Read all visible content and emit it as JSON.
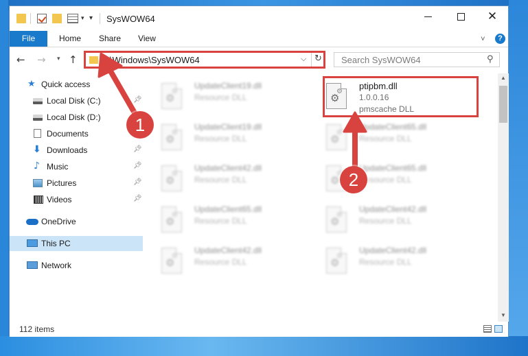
{
  "window": {
    "title": "SysWOW64"
  },
  "ribbon": {
    "tabs": [
      "File",
      "Home",
      "Share",
      "View"
    ],
    "help_label": "?"
  },
  "navbar": {
    "address": "C:\\Windows\\SysWOW64",
    "search_placeholder": "Search SysWOW64"
  },
  "sidebar": {
    "items": [
      {
        "label": "Quick access",
        "icon": "star-icon"
      },
      {
        "label": "Local Disk (C:)",
        "icon": "drive-icon",
        "pinned": true
      },
      {
        "label": "Local Disk (D:)",
        "icon": "drive-icon"
      },
      {
        "label": "Documents",
        "icon": "documents-icon",
        "pinned": true
      },
      {
        "label": "Downloads",
        "icon": "download-icon",
        "pinned": true
      },
      {
        "label": "Music",
        "icon": "music-icon",
        "pinned": true
      },
      {
        "label": "Pictures",
        "icon": "pictures-icon",
        "pinned": true
      },
      {
        "label": "Videos",
        "icon": "videos-icon",
        "pinned": true
      },
      {
        "label": "OneDrive",
        "icon": "cloud-icon"
      },
      {
        "label": "This PC",
        "icon": "computer-icon",
        "selected": true
      },
      {
        "label": "Network",
        "icon": "network-icon"
      }
    ]
  },
  "files": {
    "highlighted": {
      "name": "ptipbm.dll",
      "version": "1.0.0.16",
      "description": "pmscache DLL"
    },
    "blurred": [
      {
        "name": "UpdateClient19.dll",
        "type": "Resource DLL"
      },
      {
        "name": "UpdateClient19.dll",
        "type": "Resource DLL"
      },
      {
        "name": "UpdateClient65.dll",
        "type": "Resource DLL"
      },
      {
        "name": "UpdateClient42.dll",
        "type": "Resource DLL"
      },
      {
        "name": "UpdateClient65.dll",
        "type": "Resource DLL"
      },
      {
        "name": "UpdateClient42.dll",
        "type": "Resource DLL"
      },
      {
        "name": "UpdateClient65.dll",
        "type": "Resource DLL"
      },
      {
        "name": "UpdateClient42.dll",
        "type": "Resource DLL"
      },
      {
        "name": "UpdateClient42.dll",
        "type": "Resource DLL"
      }
    ]
  },
  "status": {
    "item_count": "112 items"
  },
  "annotations": {
    "step1": "1",
    "step2": "2",
    "color": "#d9433f"
  },
  "colors": {
    "accent": "#1979ca",
    "selection": "#cce4f7",
    "highlight": "#d9433f"
  }
}
